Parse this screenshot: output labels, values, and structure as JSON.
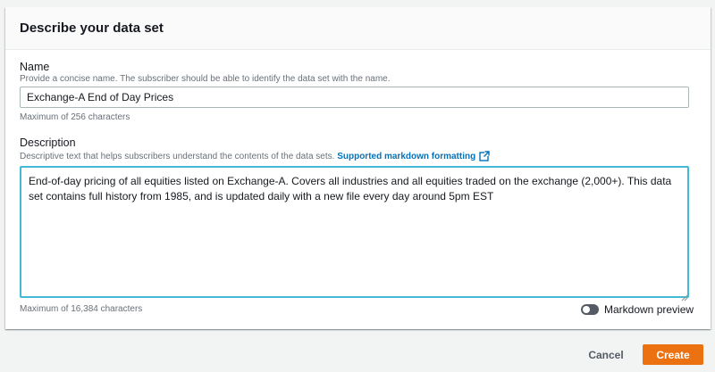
{
  "panel": {
    "title": "Describe your data set"
  },
  "name_field": {
    "label": "Name",
    "description": "Provide a concise name. The subscriber should be able to identify the data set with the name.",
    "value": "Exchange-A End of Day Prices",
    "constraint": "Maximum of 256 characters"
  },
  "description_field": {
    "label": "Description",
    "description": "Descriptive text that helps subscribers understand the contents of the data sets.",
    "link_text": "Supported markdown formatting",
    "value": "End-of-day pricing of all equities listed on Exchange-A. Covers all industries and all equities traded on the exchange (2,000+). This data set contains full history from 1985, and is updated daily with a new file every day around 5pm EST",
    "constraint": "Maximum of 16,384 characters"
  },
  "markdown_preview": {
    "label": "Markdown preview",
    "enabled": false
  },
  "footer": {
    "cancel_label": "Cancel",
    "create_label": "Create"
  },
  "colors": {
    "primary_button": "#ec7211",
    "link": "#0073bb",
    "focus_border": "#44b9d6",
    "toggle_off": "#545b64"
  },
  "icons": {
    "external_link": "external-link-icon",
    "resize": "resize-handle-icon"
  }
}
